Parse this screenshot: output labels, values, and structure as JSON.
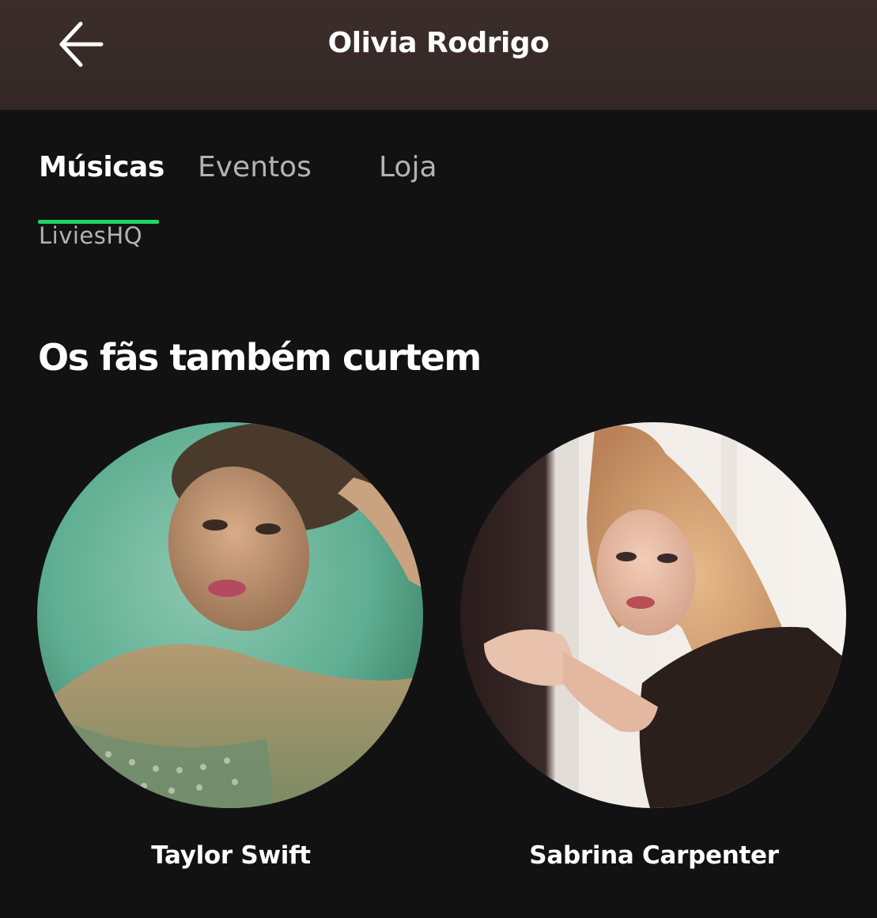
{
  "header": {
    "title": "Olivia Rodrigo",
    "back_icon": "arrow-left-icon"
  },
  "tabs": [
    {
      "label": "Músicas",
      "active": true
    },
    {
      "label": "Eventos",
      "active": false
    },
    {
      "label": "Loja",
      "active": false
    }
  ],
  "watermark": "LiviesHQ",
  "section": {
    "title": "Os fãs também curtem",
    "artists": [
      {
        "name": "Taylor Swift"
      },
      {
        "name": "Sabrina Carpenter"
      }
    ]
  },
  "colors": {
    "background": "#121212",
    "header": "#3b2d2a",
    "accent": "#1ed760",
    "text_primary": "#ffffff",
    "text_secondary": "#b3b3b3"
  }
}
